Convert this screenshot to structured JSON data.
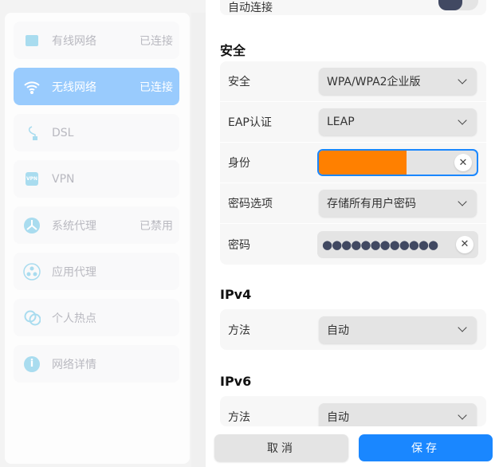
{
  "sidebar": {
    "items": [
      {
        "label": "有线网络",
        "status": "已连接",
        "icon": "ethernet-icon"
      },
      {
        "label": "无线网络",
        "status": "已连接",
        "icon": "wifi-icon",
        "active": true
      },
      {
        "label": "DSL",
        "status": "",
        "icon": "dsl-icon"
      },
      {
        "label": "VPN",
        "status": "",
        "icon": "vpn-icon"
      },
      {
        "label": "系统代理",
        "status": "已禁用",
        "icon": "system-proxy-icon"
      },
      {
        "label": "应用代理",
        "status": "",
        "icon": "app-proxy-icon"
      },
      {
        "label": "个人热点",
        "status": "",
        "icon": "hotspot-icon"
      },
      {
        "label": "网络详情",
        "status": "",
        "icon": "info-icon"
      }
    ],
    "vpn_badge": "VPN"
  },
  "main": {
    "auto_connect_label": "自动连接",
    "security": {
      "title": "安全",
      "security_label": "安全",
      "security_value": "WPA/WPA2企业版",
      "eap_label": "EAP认证",
      "eap_value": "LEAP",
      "identity_label": "身份",
      "pwd_option_label": "密码选项",
      "pwd_option_value": "存储所有用户密码",
      "password_label": "密码",
      "password_mask": "●●●●●●●●●●●●"
    },
    "ipv4": {
      "title": "IPv4",
      "method_label": "方法",
      "method_value": "自动"
    },
    "ipv6": {
      "title": "IPv6",
      "method_label": "方法",
      "method_value": "自动"
    },
    "cancel": "取消",
    "save": "保存",
    "accent": "#1a87ff"
  }
}
